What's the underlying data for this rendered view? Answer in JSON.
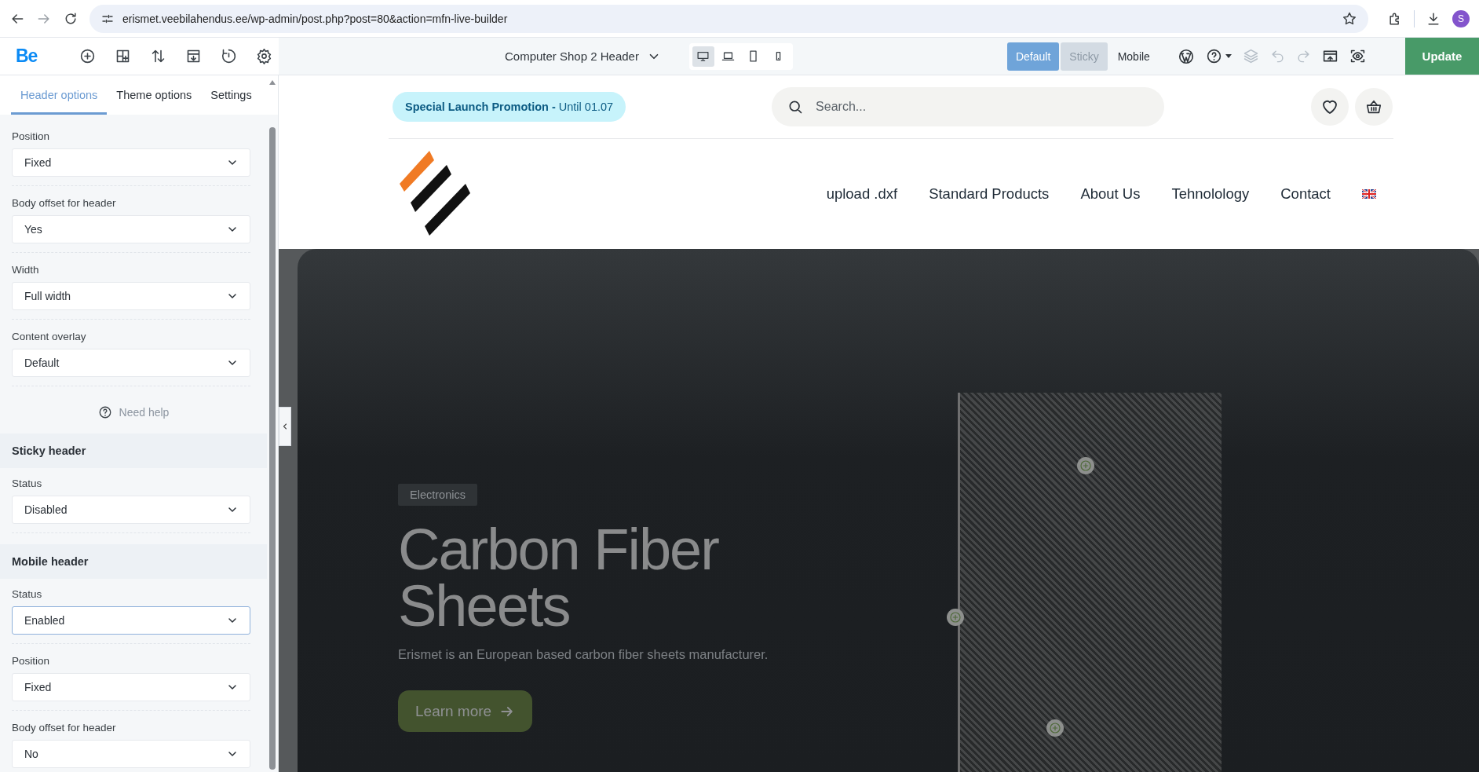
{
  "browser": {
    "url": "erismet.veebilahendus.ee/wp-admin/post.php?post=80&action=mfn-live-builder",
    "profile_initial": "S"
  },
  "toolbar": {
    "logo": "Be",
    "template_title": "Computer Shop 2 Header",
    "devices": [
      {
        "kind": "desktop",
        "selected": true
      },
      {
        "kind": "laptop",
        "selected": false
      },
      {
        "kind": "tablet",
        "selected": false
      },
      {
        "kind": "phone",
        "selected": false
      }
    ],
    "modes": [
      {
        "label": "Default",
        "selected": true,
        "disabled": false
      },
      {
        "label": "Sticky",
        "selected": false,
        "disabled": true
      },
      {
        "label": "Mobile",
        "selected": false,
        "disabled": false
      }
    ],
    "update_button": "Update"
  },
  "sidebar": {
    "tabs": [
      {
        "label": "Header options",
        "selected": true
      },
      {
        "label": "Theme options",
        "selected": false
      },
      {
        "label": "Settings",
        "selected": false
      }
    ],
    "sections": [
      {
        "fields": [
          {
            "label": "Position",
            "value": "Fixed",
            "focused": false
          },
          {
            "label": "Body offset for header",
            "value": "Yes",
            "focused": false
          },
          {
            "label": "Width",
            "value": "Full width",
            "focused": false
          },
          {
            "label": "Content overlay",
            "value": "Default",
            "focused": false
          }
        ],
        "help": "Need help"
      },
      {
        "title": "Sticky header",
        "fields": [
          {
            "label": "Status",
            "value": "Disabled",
            "focused": false
          }
        ]
      },
      {
        "title": "Mobile header",
        "fields": [
          {
            "label": "Status",
            "value": "Enabled",
            "focused": true
          },
          {
            "label": "Position",
            "value": "Fixed",
            "focused": false
          },
          {
            "label": "Body offset for header",
            "value": "No",
            "focused": false
          }
        ]
      }
    ]
  },
  "preview": {
    "promo": "**Special Launch Promotion -** Until 01.07",
    "search": {
      "placeholder": "Search..."
    },
    "nav": [
      "upload .dxf",
      "Standard Products",
      "About Us",
      "Tehnolology",
      "Contact"
    ],
    "hero": {
      "tag": "Electronics",
      "title": "Carbon Fiber Sheets",
      "subtitle": "Erismet is an European based carbon fiber sheets manufacturer.",
      "button": "Learn more"
    }
  }
}
